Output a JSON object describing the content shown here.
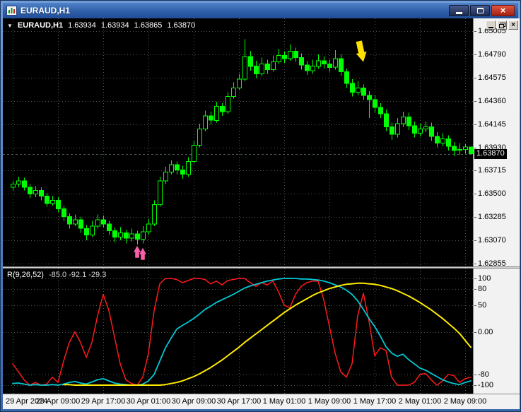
{
  "window": {
    "title": "EURAUD,H1"
  },
  "quote": {
    "symbol": "EURAUD,H1",
    "open": "1.63934",
    "high": "1.63934",
    "low": "1.63865",
    "close": "1.63870"
  },
  "indicator_header": {
    "name": "R(9,26,52)",
    "values": "-85.0 -92.1 -29.3"
  },
  "theme": {
    "chart_bg": "#000000",
    "grid": "#4a5a4a",
    "candle": "#00ff00",
    "bull_fill": "#000000",
    "bid_line": "#4a5a5a",
    "axis_bg": "#f2f2f2",
    "axis_text": "#000000",
    "tag_bg": "#000000",
    "tag_text": "#ffffff",
    "titlebar": "#2f5ea9",
    "close_button": "#c0271a"
  },
  "chart_data": {
    "type": "candlestick",
    "symbol": "EURAUD",
    "timeframe": "H1",
    "ylim": [
      1.62855,
      1.65005
    ],
    "price_gridlines": [
      1.65005,
      1.6479,
      1.64575,
      1.6436,
      1.64145,
      1.6393,
      1.63715,
      1.635,
      1.63285,
      1.6307,
      1.62855
    ],
    "price_grid_labels": [
      "1.65005",
      "1.64790",
      "1.64575",
      "1.64360",
      "1.64145",
      "1.63930",
      "1.63715",
      "1.63500",
      "1.63285",
      "1.63070",
      "1.62855"
    ],
    "bid": 1.6387,
    "bid_label": "1.63870",
    "x_tick_indices": [
      0,
      8,
      16,
      24,
      32,
      40,
      48,
      56,
      64,
      72,
      80
    ],
    "x_tick_labels": [
      "29 Apr 2024",
      "29 Apr 09:00",
      "29 Apr 17:00",
      "30 Apr 01:00",
      "30 Apr 09:00",
      "30 Apr 17:00",
      "1 May 01:00",
      "1 May 09:00",
      "1 May 17:00",
      "2 May 01:00",
      "2 May 09:00"
    ],
    "candles_ohlc": [
      [
        1.6356,
        1.6362,
        1.6353,
        1.6359
      ],
      [
        1.6359,
        1.6366,
        1.6356,
        1.6362
      ],
      [
        1.6362,
        1.6365,
        1.6353,
        1.6356
      ],
      [
        1.6356,
        1.6359,
        1.6346,
        1.635
      ],
      [
        1.635,
        1.6357,
        1.6347,
        1.6353
      ],
      [
        1.6353,
        1.6356,
        1.6344,
        1.6348
      ],
      [
        1.6348,
        1.6351,
        1.6338,
        1.6341
      ],
      [
        1.6341,
        1.6348,
        1.6339,
        1.6344
      ],
      [
        1.6344,
        1.6347,
        1.6333,
        1.6336
      ],
      [
        1.6336,
        1.6339,
        1.6325,
        1.6329
      ],
      [
        1.6329,
        1.6332,
        1.6318,
        1.6322
      ],
      [
        1.6322,
        1.6331,
        1.632,
        1.6326
      ],
      [
        1.6326,
        1.6329,
        1.6314,
        1.6318
      ],
      [
        1.6318,
        1.6321,
        1.6307,
        1.6312
      ],
      [
        1.6312,
        1.6325,
        1.631,
        1.632
      ],
      [
        1.632,
        1.6331,
        1.6318,
        1.6326
      ],
      [
        1.6326,
        1.633,
        1.6319,
        1.6322
      ],
      [
        1.6322,
        1.6325,
        1.6312,
        1.6316
      ],
      [
        1.6316,
        1.6319,
        1.6305,
        1.631
      ],
      [
        1.631,
        1.6319,
        1.6307,
        1.6314
      ],
      [
        1.6314,
        1.6317,
        1.6304,
        1.6309
      ],
      [
        1.6309,
        1.6318,
        1.6306,
        1.6313
      ],
      [
        1.6313,
        1.6316,
        1.6303,
        1.6308
      ],
      [
        1.6308,
        1.632,
        1.6304,
        1.6315
      ],
      [
        1.6315,
        1.6327,
        1.6312,
        1.6322
      ],
      [
        1.6322,
        1.6344,
        1.632,
        1.634
      ],
      [
        1.634,
        1.6366,
        1.6338,
        1.6362
      ],
      [
        1.6362,
        1.6375,
        1.6359,
        1.637
      ],
      [
        1.637,
        1.6381,
        1.6368,
        1.6377
      ],
      [
        1.6377,
        1.638,
        1.6368,
        1.6372
      ],
      [
        1.6372,
        1.6376,
        1.6364,
        1.6368
      ],
      [
        1.6368,
        1.6384,
        1.6366,
        1.638
      ],
      [
        1.638,
        1.6399,
        1.6378,
        1.6395
      ],
      [
        1.6395,
        1.6415,
        1.6393,
        1.641
      ],
      [
        1.641,
        1.6427,
        1.6408,
        1.6422
      ],
      [
        1.6422,
        1.6426,
        1.6414,
        1.6418
      ],
      [
        1.6418,
        1.6435,
        1.6416,
        1.6431
      ],
      [
        1.6431,
        1.6434,
        1.6422,
        1.6426
      ],
      [
        1.6426,
        1.6444,
        1.6424,
        1.644
      ],
      [
        1.644,
        1.6453,
        1.6438,
        1.6448
      ],
      [
        1.6448,
        1.6461,
        1.6446,
        1.6456
      ],
      [
        1.6456,
        1.6493,
        1.6454,
        1.6477
      ],
      [
        1.6477,
        1.6482,
        1.6464,
        1.6468
      ],
      [
        1.6468,
        1.6473,
        1.6457,
        1.6461
      ],
      [
        1.6461,
        1.6476,
        1.6459,
        1.647
      ],
      [
        1.647,
        1.6474,
        1.6461,
        1.6465
      ],
      [
        1.6465,
        1.6478,
        1.6463,
        1.6472
      ],
      [
        1.6472,
        1.6484,
        1.647,
        1.6478
      ],
      [
        1.6478,
        1.6482,
        1.6471,
        1.6475
      ],
      [
        1.6475,
        1.6488,
        1.6473,
        1.6482
      ],
      [
        1.6482,
        1.6485,
        1.6472,
        1.6476
      ],
      [
        1.6476,
        1.648,
        1.6465,
        1.6469
      ],
      [
        1.6469,
        1.6473,
        1.646,
        1.6464
      ],
      [
        1.6464,
        1.6474,
        1.6461,
        1.6468
      ],
      [
        1.6468,
        1.6479,
        1.6466,
        1.6473
      ],
      [
        1.6473,
        1.6477,
        1.6466,
        1.647
      ],
      [
        1.647,
        1.6474,
        1.6463,
        1.6467
      ],
      [
        1.6467,
        1.6483,
        1.6465,
        1.6475
      ],
      [
        1.6475,
        1.6479,
        1.6459,
        1.6463
      ],
      [
        1.6463,
        1.6466,
        1.6448,
        1.6452
      ],
      [
        1.6452,
        1.6456,
        1.644,
        1.6444
      ],
      [
        1.6444,
        1.6454,
        1.6441,
        1.6448
      ],
      [
        1.6448,
        1.6451,
        1.6437,
        1.6441
      ],
      [
        1.6441,
        1.6445,
        1.642,
        1.6437
      ],
      [
        1.6437,
        1.6441,
        1.6425,
        1.643
      ],
      [
        1.643,
        1.6434,
        1.642,
        1.6424
      ],
      [
        1.6424,
        1.6428,
        1.6408,
        1.6412
      ],
      [
        1.6412,
        1.6416,
        1.64,
        1.6405
      ],
      [
        1.6405,
        1.642,
        1.6402,
        1.6415
      ],
      [
        1.6415,
        1.6426,
        1.6412,
        1.6421
      ],
      [
        1.6421,
        1.6425,
        1.6409,
        1.6413
      ],
      [
        1.6413,
        1.6417,
        1.6402,
        1.6406
      ],
      [
        1.6406,
        1.6415,
        1.6403,
        1.641
      ],
      [
        1.641,
        1.6417,
        1.6407,
        1.6412
      ],
      [
        1.6412,
        1.6416,
        1.6399,
        1.6403
      ],
      [
        1.6403,
        1.6407,
        1.6393,
        1.6397
      ],
      [
        1.6397,
        1.6406,
        1.6394,
        1.6401
      ],
      [
        1.6401,
        1.6404,
        1.639,
        1.6394
      ],
      [
        1.6394,
        1.6398,
        1.6385,
        1.639
      ],
      [
        1.639,
        1.6397,
        1.6386,
        1.6391
      ],
      [
        1.6391,
        1.6396,
        1.6387,
        1.63934
      ],
      [
        1.63934,
        1.63934,
        1.63865,
        1.6387
      ]
    ],
    "arrows": [
      {
        "name": "buy-signal-arrow",
        "dir": "up",
        "index": 22,
        "price": 1.6302,
        "color": "#f75fa8",
        "size": 10,
        "len": 17
      },
      {
        "name": "buy-signal-arrow",
        "dir": "up",
        "index": 23,
        "price": 1.63,
        "color": "#f75fa8",
        "size": 10,
        "len": 17
      },
      {
        "name": "sell-signal-arrow",
        "dir": "down",
        "index": 62,
        "price": 1.6472,
        "color": "#ffe100",
        "size": 15,
        "len": 30,
        "tilt": -12
      }
    ],
    "oscillator": {
      "name": "R(9,26,52)",
      "ylim": [
        -100,
        100
      ],
      "levels": [
        100,
        80,
        50,
        0,
        -80,
        -100
      ],
      "scale": [
        {
          "value": 100,
          "text": "100"
        },
        {
          "value": 80,
          "text": "80"
        },
        {
          "value": 50,
          "text": "50"
        },
        {
          "value": 0,
          "text": "0.00"
        },
        {
          "value": -80,
          "text": "-80"
        },
        {
          "value": -100,
          "text": "-100"
        }
      ],
      "current": [
        -85.0,
        -92.1,
        -29.3
      ],
      "series": [
        {
          "name": "fast",
          "color": "#ff1a1a",
          "width": 1.5,
          "values": [
            -60,
            -75,
            -90,
            -100,
            -95,
            -100,
            -98,
            -85,
            -95,
            -55,
            -20,
            0,
            -20,
            -48,
            -20,
            30,
            70,
            40,
            -10,
            -60,
            -90,
            -97,
            -100,
            -85,
            -40,
            40,
            90,
            100,
            100,
            98,
            92,
            96,
            100,
            100,
            98,
            90,
            95,
            88,
            96,
            98,
            100,
            100,
            92,
            85,
            92,
            88,
            95,
            75,
            50,
            45,
            70,
            85,
            92,
            95,
            95,
            60,
            10,
            -40,
            -75,
            -85,
            -60,
            30,
            72,
            20,
            -45,
            -30,
            -35,
            -85,
            -100,
            -100,
            -100,
            -95,
            -80,
            -78,
            -90,
            -100,
            -92,
            -80,
            -82,
            -95,
            -88,
            -85
          ]
        },
        {
          "name": "medium",
          "color": "#00c8d4",
          "width": 1.8,
          "values": [
            -97,
            -96,
            -98,
            -100,
            -99,
            -100,
            -100,
            -99,
            -100,
            -98,
            -95,
            -93,
            -96,
            -98,
            -94,
            -90,
            -88,
            -92,
            -96,
            -98,
            -99,
            -100,
            -100,
            -98,
            -92,
            -80,
            -55,
            -30,
            -12,
            5,
            12,
            18,
            25,
            33,
            42,
            48,
            55,
            60,
            65,
            70,
            76,
            82,
            86,
            89,
            92,
            95,
            97,
            99,
            100,
            100,
            100,
            99,
            99,
            98,
            97,
            95,
            92,
            88,
            84,
            78,
            70,
            58,
            42,
            25,
            10,
            -8,
            -28,
            -40,
            -46,
            -42,
            -52,
            -60,
            -68,
            -72,
            -78,
            -84,
            -90,
            -94,
            -97,
            -99,
            -95,
            -92
          ]
        },
        {
          "name": "slow",
          "color": "#ffeb00",
          "width": 2,
          "values": [
            null,
            null,
            null,
            null,
            null,
            null,
            null,
            null,
            null,
            -99,
            -99,
            -100,
            -100,
            -100,
            -100,
            -100,
            -100,
            -100,
            -100,
            -100,
            -100,
            -100,
            -100,
            -100,
            -100,
            -100,
            -100,
            -99,
            -97,
            -95,
            -92,
            -88,
            -84,
            -79,
            -73,
            -67,
            -60,
            -53,
            -45,
            -37,
            -29,
            -20,
            -12,
            -4,
            4,
            12,
            20,
            28,
            36,
            43,
            50,
            56,
            62,
            68,
            73,
            77,
            81,
            84,
            87,
            89,
            90,
            91,
            91,
            90,
            89,
            87,
            84,
            81,
            77,
            72,
            67,
            61,
            55,
            48,
            41,
            33,
            25,
            16,
            7,
            -3,
            -16,
            -29
          ]
        }
      ]
    }
  }
}
